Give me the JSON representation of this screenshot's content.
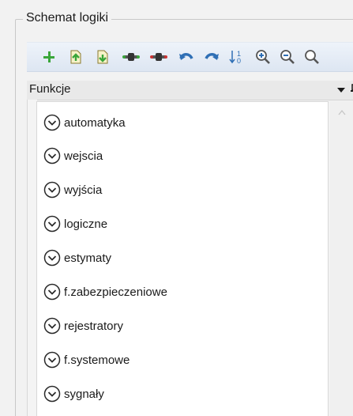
{
  "groupbox": {
    "title": "Schemat logiki"
  },
  "toolbar": {
    "buttons": [
      {
        "name": "add-icon"
      },
      {
        "name": "export-icon"
      },
      {
        "name": "import-icon"
      },
      {
        "name": "connector-icon"
      },
      {
        "name": "connector-remove-icon"
      },
      {
        "name": "undo-icon"
      },
      {
        "name": "redo-icon"
      },
      {
        "name": "sort-icon"
      },
      {
        "name": "zoom-in-icon"
      },
      {
        "name": "zoom-out-icon"
      },
      {
        "name": "zoom-fit-icon"
      }
    ]
  },
  "panel": {
    "title": "Funkcje",
    "items": [
      {
        "label": "automatyka"
      },
      {
        "label": "wejscia"
      },
      {
        "label": "wyjścia"
      },
      {
        "label": "logiczne"
      },
      {
        "label": "estymaty"
      },
      {
        "label": "f.zabezpieczeniowe"
      },
      {
        "label": "rejestratory"
      },
      {
        "label": "f.systemowe"
      },
      {
        "label": "sygnały"
      }
    ]
  },
  "colors": {
    "toolbar_bg": "#e3eaf4",
    "icon_green": "#3aa63a",
    "icon_blue": "#2f6fb5",
    "icon_gray": "#666666"
  }
}
